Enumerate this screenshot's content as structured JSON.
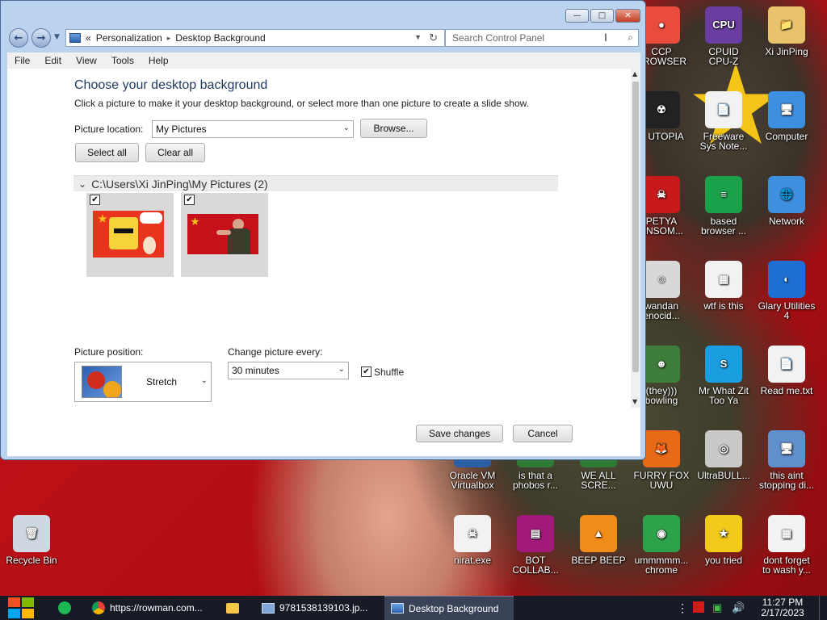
{
  "window": {
    "address": {
      "prefix": "«",
      "path": [
        "Personalization",
        "Desktop Background"
      ],
      "separator": "▸"
    },
    "search_placeholder": "Search Control Panel",
    "menu": [
      "File",
      "Edit",
      "View",
      "Tools",
      "Help"
    ],
    "heading": "Choose your desktop background",
    "description": "Click a picture to make it your desktop background, or select more than one picture to create a slide show.",
    "picture_location_label": "Picture location:",
    "picture_location_value": "My Pictures",
    "browse_label": "Browse...",
    "select_all_label": "Select all",
    "clear_all_label": "Clear all",
    "group_path": "C:\\Users\\Xi JinPing\\My Pictures (2)",
    "group_chevron": "⌄",
    "picture_position_label": "Picture position:",
    "picture_position_value": "Stretch",
    "change_picture_label": "Change picture every:",
    "change_picture_value": "30 minutes",
    "shuffle_label": "Shuffle",
    "shuffle_checked": true,
    "save_label": "Save changes",
    "cancel_label": "Cancel",
    "caption_minimize": "—",
    "caption_maximize": "□",
    "caption_close": "✕"
  },
  "thumbnails": [
    {
      "checked": true
    },
    {
      "checked": true
    }
  ],
  "desktop_icons": [
    {
      "label": "CCP\nBROWSER",
      "color": "#e94c3d",
      "glyph": "●"
    },
    {
      "label": "CPUID\nCPU-Z",
      "color": "#6a3ea0",
      "glyph": "CPU"
    },
    {
      "label": "Xi JinPing",
      "color": "#e9c36b",
      "glyph": "📁"
    },
    {
      "label": "P UTOPIA",
      "color": "#222222",
      "glyph": "☢"
    },
    {
      "label": "Freeware\nSys Note...",
      "color": "#f2f2f2",
      "glyph": "📄"
    },
    {
      "label": "Computer",
      "color": "#3f8fe0",
      "glyph": "🖥"
    },
    {
      "label": "PETYA\nANSOM...",
      "color": "#c81a1a",
      "glyph": "☠"
    },
    {
      "label": "based\nbrowser ...",
      "color": "#1aa14a",
      "glyph": "≡"
    },
    {
      "label": "Network",
      "color": "#3f8fe0",
      "glyph": "🌐"
    },
    {
      "label": "wandan\nenocid...",
      "color": "#d8d8d8",
      "glyph": "☺"
    },
    {
      "label": "wtf is this",
      "color": "#f2f2f2",
      "glyph": "▦"
    },
    {
      "label": "Glary Utilities\n4",
      "color": "#1d6fd1",
      "glyph": "◐"
    },
    {
      "label": "(they)))\nbowling",
      "color": "#3f7d3a",
      "glyph": "☻"
    },
    {
      "label": "Mr What Zit\nToo Ya",
      "color": "#1a9ee0",
      "glyph": "S"
    },
    {
      "label": "Read me.txt",
      "color": "#f2f2f2",
      "glyph": "📄"
    },
    {
      "label": "Oracle VM\nVirtualbox",
      "color": "#2a5fa6",
      "glyph": "◆"
    },
    {
      "label": "is that a\nphobos r...",
      "color": "#2f7a34",
      "glyph": "◉"
    },
    {
      "label": "WE ALL\nSCRE...",
      "color": "#2f7a34",
      "glyph": "▲"
    },
    {
      "label": "FURRY FOX\nUWU",
      "color": "#e66a17",
      "glyph": "🦊"
    },
    {
      "label": "UltraBULL...",
      "color": "#c9c9c9",
      "glyph": "◎"
    },
    {
      "label": "this aint\nstopping di...",
      "color": "#5f8fcc",
      "glyph": "🖥"
    },
    {
      "label": "Recycle Bin",
      "color": "#cfd8e0",
      "glyph": "🗑"
    },
    {
      "label": "nirat.exe",
      "color": "#f2f2f2",
      "glyph": "☠"
    },
    {
      "label": "BOT\nCOLLAB...",
      "color": "#a11a7a",
      "glyph": "▤"
    },
    {
      "label": "BEEP BEEP",
      "color": "#f08c1a",
      "glyph": "▲"
    },
    {
      "label": "ummmmm...\nchrome",
      "color": "#2ea24a",
      "glyph": "◉"
    },
    {
      "label": "you tried",
      "color": "#f2cb1a",
      "glyph": "★"
    },
    {
      "label": "dont forget\nto wash y...",
      "color": "#f2f2f2",
      "glyph": "▦"
    }
  ],
  "taskbar": {
    "items": [
      {
        "label": "https://rowman.com...",
        "icon": "chrome-icon"
      },
      {
        "label": "",
        "icon": "folder-icon"
      },
      {
        "label": "9781538139103.jp...",
        "icon": "image-viewer-icon"
      },
      {
        "label": "Desktop Background",
        "icon": "control-panel-icon"
      }
    ],
    "time": "11:27 PM",
    "date": "2/17/2023"
  }
}
